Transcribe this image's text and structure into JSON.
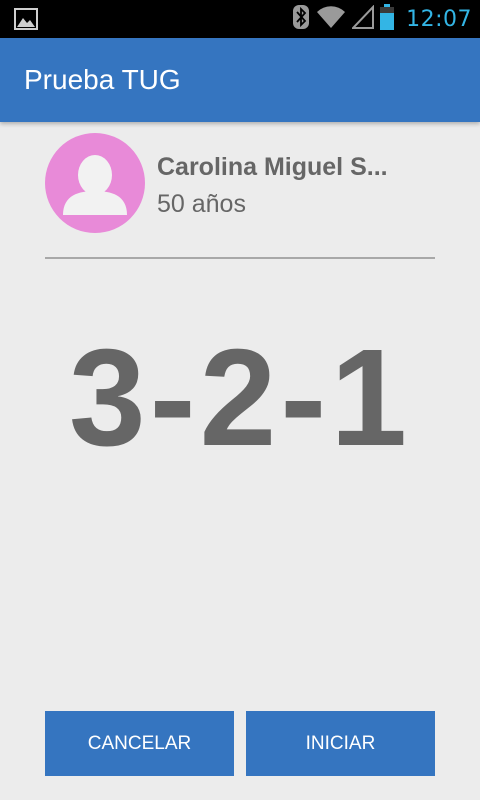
{
  "status_bar": {
    "time": "12:07",
    "icons": [
      "gallery-notification-icon",
      "bluetooth-icon",
      "wifi-icon",
      "signal-icon",
      "battery-icon"
    ]
  },
  "app_bar": {
    "title": "Prueba TUG",
    "color": "#3575c0"
  },
  "patient": {
    "name": "Carolina Miguel S...",
    "age": "50 años",
    "avatar_color": "#e88ad8"
  },
  "countdown": "3-2-1",
  "buttons": {
    "cancel": "CANCELAR",
    "start": "INICIAR"
  }
}
